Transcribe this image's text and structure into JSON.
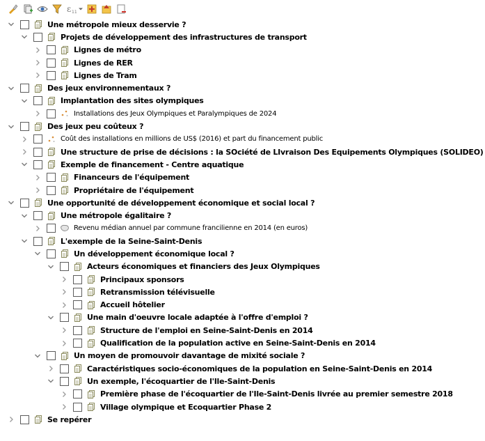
{
  "toolbar": {
    "buttons": [
      {
        "name": "style-manager-icon"
      },
      {
        "name": "add-group-icon"
      },
      {
        "name": "manage-visibility-icon"
      },
      {
        "name": "filter-legend-icon"
      },
      {
        "name": "filter-by-expression-icon",
        "dropdown": true
      },
      {
        "name": "expand-all-icon"
      },
      {
        "name": "collapse-all-icon"
      },
      {
        "name": "remove-layer-icon"
      }
    ]
  },
  "tree": [
    {
      "depth": 0,
      "expanded": true,
      "icon": "group",
      "bold": true,
      "label": "Une métropole mieux desservie ?"
    },
    {
      "depth": 1,
      "expanded": true,
      "icon": "group",
      "bold": true,
      "label": "Projets de développement des infrastructures de transport"
    },
    {
      "depth": 2,
      "expanded": false,
      "icon": "group",
      "bold": true,
      "label": "Lignes de métro"
    },
    {
      "depth": 2,
      "expanded": false,
      "icon": "group",
      "bold": true,
      "label": "Lignes de RER"
    },
    {
      "depth": 2,
      "expanded": false,
      "icon": "group",
      "bold": true,
      "label": "Lignes de Tram"
    },
    {
      "depth": 0,
      "expanded": true,
      "icon": "group",
      "bold": true,
      "label": "Des jeux environnementaux ?"
    },
    {
      "depth": 1,
      "expanded": true,
      "icon": "group",
      "bold": true,
      "label": "Implantation des sites olympiques"
    },
    {
      "depth": 2,
      "expanded": false,
      "icon": "point",
      "bold": false,
      "label": "Installations des Jeux Olympiques et Paralympiques de 2024"
    },
    {
      "depth": 0,
      "expanded": true,
      "icon": "group",
      "bold": true,
      "label": "Des jeux peu coûteux ?"
    },
    {
      "depth": 1,
      "expanded": false,
      "icon": "point",
      "bold": false,
      "label": "Coût des installations en millions de US$ (2016) et part du financement public"
    },
    {
      "depth": 1,
      "expanded": false,
      "icon": "group",
      "bold": true,
      "label": "Une structure de prise de décisions :  la SOciété de LIvraison Des Equipements Olympiques (SOLIDEO)"
    },
    {
      "depth": 1,
      "expanded": true,
      "icon": "group",
      "bold": true,
      "label": "Exemple de financement - Centre aquatique"
    },
    {
      "depth": 2,
      "expanded": false,
      "icon": "group",
      "bold": true,
      "label": "Financeurs de l'équipement"
    },
    {
      "depth": 2,
      "expanded": false,
      "icon": "group",
      "bold": true,
      "label": "Propriétaire de l'équipement"
    },
    {
      "depth": 0,
      "expanded": true,
      "icon": "group",
      "bold": true,
      "label": "Une opportunité de développement économique et social local ?"
    },
    {
      "depth": 1,
      "expanded": true,
      "icon": "group",
      "bold": true,
      "label": "Une métropole égalitaire ?"
    },
    {
      "depth": 2,
      "expanded": false,
      "icon": "polygon",
      "bold": false,
      "label": "Revenu médian annuel par commune francilienne en 2014 (en euros)"
    },
    {
      "depth": 1,
      "expanded": true,
      "icon": "group",
      "bold": true,
      "label": "L'exemple de la Seine-Saint-Denis"
    },
    {
      "depth": 2,
      "expanded": true,
      "icon": "group",
      "bold": true,
      "label": "Un développement économique local ?"
    },
    {
      "depth": 3,
      "expanded": true,
      "icon": "group",
      "bold": true,
      "label": "Acteurs économiques et financiers des Jeux Olympiques"
    },
    {
      "depth": 4,
      "expanded": false,
      "icon": "group",
      "bold": true,
      "label": "Principaux sponsors"
    },
    {
      "depth": 4,
      "expanded": false,
      "icon": "group",
      "bold": true,
      "label": "Retransmission télévisuelle"
    },
    {
      "depth": 4,
      "expanded": false,
      "icon": "group",
      "bold": true,
      "label": "Accueil hôtelier"
    },
    {
      "depth": 3,
      "expanded": true,
      "icon": "group",
      "bold": true,
      "label": "Une main d'oeuvre locale adaptée à l'offre d'emploi ?"
    },
    {
      "depth": 4,
      "expanded": false,
      "icon": "group",
      "bold": true,
      "label": "Structure de l'emploi en Seine-Saint-Denis en 2014"
    },
    {
      "depth": 4,
      "expanded": false,
      "icon": "group",
      "bold": true,
      "label": "Qualification de la population active en Seine-Saint-Denis en 2014"
    },
    {
      "depth": 2,
      "expanded": true,
      "icon": "group",
      "bold": true,
      "label": "Un moyen de promouvoir davantage de mixité sociale ?"
    },
    {
      "depth": 3,
      "expanded": false,
      "icon": "group",
      "bold": true,
      "label": "Caractéristiques socio-économiques de la population en Seine-Saint-Denis en 2014"
    },
    {
      "depth": 3,
      "expanded": true,
      "icon": "group",
      "bold": true,
      "label": "Un exemple, l'écoquartier de l'Ile-Saint-Denis"
    },
    {
      "depth": 4,
      "expanded": false,
      "icon": "group",
      "bold": true,
      "label": "Première phase de l'écoquartier de l'Ile-Saint-Denis livrée au premier semestre 2018"
    },
    {
      "depth": 4,
      "expanded": false,
      "icon": "group",
      "bold": true,
      "label": "Village olympique et Ecoquartier Phase 2"
    },
    {
      "depth": 0,
      "expanded": false,
      "icon": "group",
      "bold": true,
      "label": "Se repérer"
    }
  ],
  "colors": {
    "arrow": "#7a7a7a",
    "checkbox_border": "#5c5c5c",
    "group_icon": "#8a8a5c"
  }
}
